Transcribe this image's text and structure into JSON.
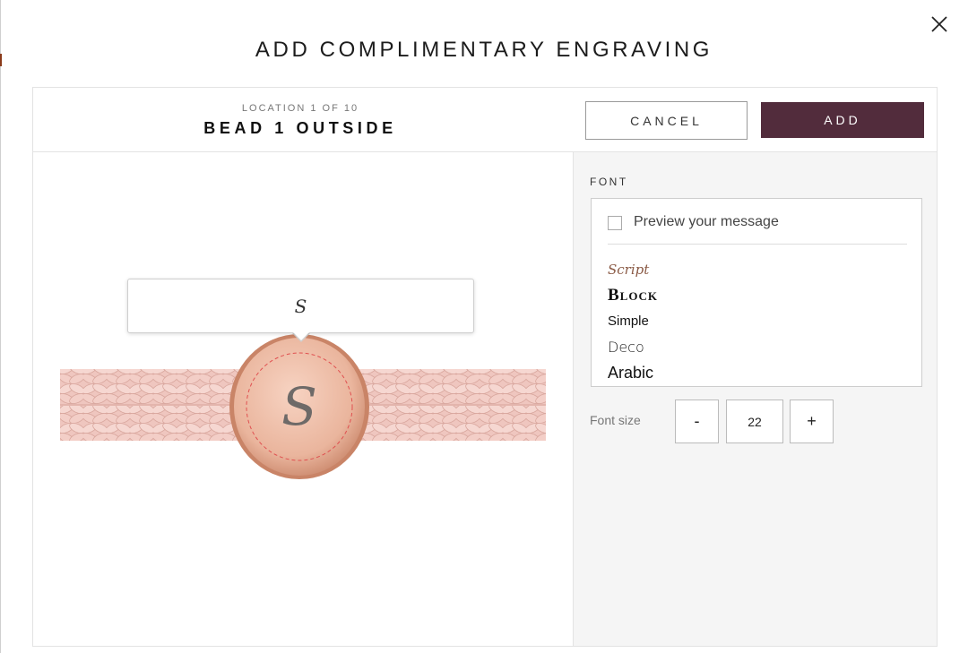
{
  "modal": {
    "title": "ADD COMPLIMENTARY ENGRAVING"
  },
  "header": {
    "location_sub": "LOCATION 1 OF 10",
    "location_main": "BEAD 1 OUTSIDE",
    "cancel_label": "CANCEL",
    "add_label": "ADD"
  },
  "preview": {
    "engraving_text": "S",
    "bead_letter": "S"
  },
  "options": {
    "font_label": "FONT",
    "preview_message_label": "Preview your message",
    "preview_message_checked": false,
    "fonts": [
      "Script",
      "Block",
      "Simple",
      "Deco",
      "Arabic"
    ],
    "font_size_label": "Font size",
    "font_size_minus": "-",
    "font_size_value": "22",
    "font_size_plus": "+"
  },
  "colors": {
    "add_button": "#522c3c",
    "bead_rose_gold": "#e7b39a",
    "cord_pink": "#efc6bf",
    "engrave_guide": "#e05050"
  },
  "icons": {
    "close": "close-icon"
  }
}
